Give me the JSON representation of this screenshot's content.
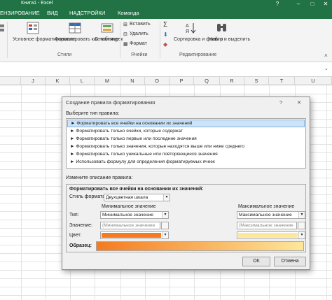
{
  "window": {
    "title": "Книга1 - Excel",
    "help_glyph": "?",
    "minimize_glyph": "–",
    "maximize_glyph": "□",
    "close_glyph": "✕",
    "ribbon_collapse_glyph": "˄"
  },
  "tabs": [
    "ЕНЗИРОВАНИЕ",
    "ВИД",
    "НАДСТРОЙКИ",
    "Команда"
  ],
  "ribbon": {
    "styles": {
      "conditional_formatting": "Условное форматирование",
      "format_as_table": "Форматировать как таблицу",
      "cell_styles": "Стили ячеек",
      "group_label": "Стили"
    },
    "cells": {
      "insert": "Вставить",
      "delete": "Удалить",
      "format": "Формат",
      "group_label": "Ячейки"
    },
    "editing": {
      "sort_filter": "Сортировка и фильтр",
      "find_select": "Найти и выделить",
      "group_label": "Редактирование"
    }
  },
  "grid": {
    "columns": [
      "J",
      "K",
      "L",
      "M",
      "N",
      "O",
      "P",
      "Q",
      "R",
      "S",
      "T",
      "U"
    ]
  },
  "dialog": {
    "title": "Создание правила форматирования",
    "help": "?",
    "close": "✕",
    "select_rule_type_label": "Выберите тип правила:",
    "rule_types": [
      "Форматировать все ячейки на основании их значений",
      "Форматировать только ячейки, которые содержат",
      "Форматировать только первые или последние значения",
      "Форматировать только значения, которые находятся выше или ниже среднего",
      "Форматировать только уникальные или повторяющиеся значения",
      "Использовать формулу для определения форматируемых ячеек"
    ],
    "selected_rule_index": 0,
    "edit_description_label": "Измените описание правила:",
    "description_heading": "Форматировать все ячейки на основании их значений:",
    "format_style_label": "Стиль формата:",
    "format_style_value": "Двухцветная шкала",
    "min_heading": "Минимальное значение",
    "max_heading": "Максимальное значение",
    "type_label": "Тип:",
    "value_label": "Значение:",
    "color_label": "Цвет:",
    "min_type": "Минимальное значение",
    "max_type": "Максимальное значение",
    "min_value_placeholder": "(Минимальное значение",
    "max_value_placeholder": "(Максимальное значение",
    "min_color": "#f47b20",
    "max_color": "#fde79b",
    "preview_label": "Образец:",
    "ok_button": "ОК",
    "cancel_button": "Отмена"
  },
  "colors": {
    "excel_green": "#217346",
    "selection_blue": "#cde3f7"
  }
}
